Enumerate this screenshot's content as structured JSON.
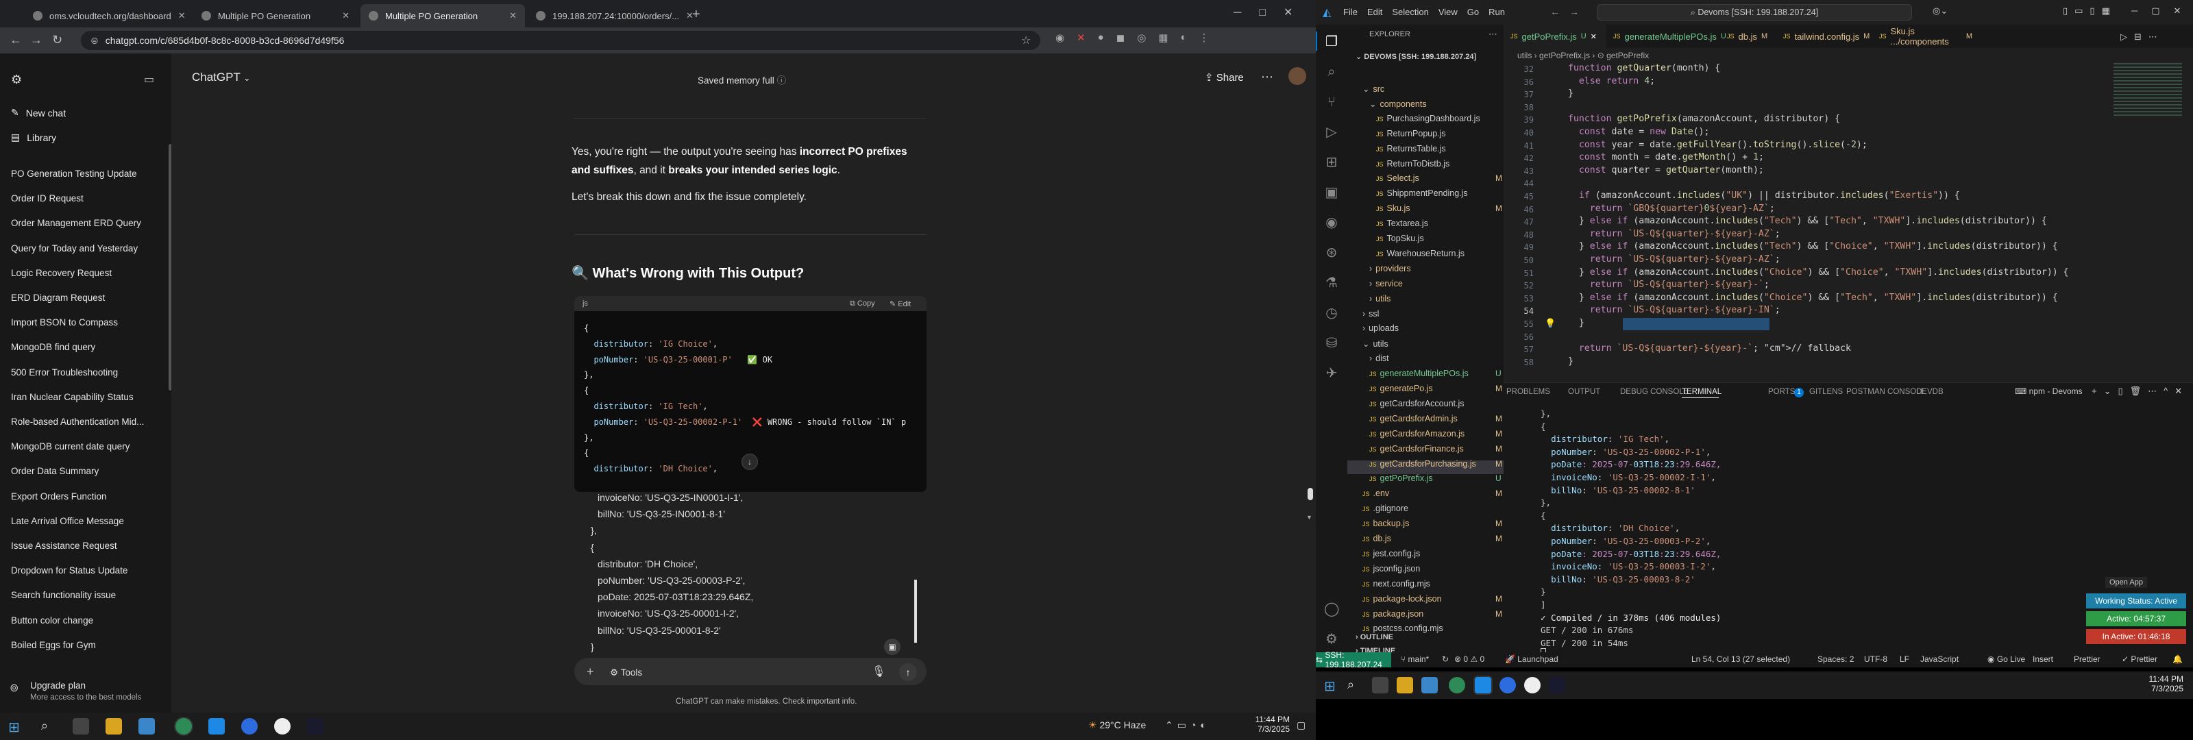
{
  "chrome": {
    "tabs": [
      {
        "label": "oms.vcloudtech.org/dashboard"
      },
      {
        "label": "Multiple PO Generation"
      },
      {
        "label": "Multiple PO Generation"
      },
      {
        "label": "199.188.207.24:10000/orders/..."
      }
    ],
    "url": "chatgpt.com/c/685d4b0f-8c8c-8008-b3cd-8696d7d49f56"
  },
  "chatgpt": {
    "model": "ChatGPT",
    "memory": "Saved memory full",
    "share": "Share",
    "sidebar": {
      "new_chat": "New chat",
      "library": "Library",
      "history": [
        "PO Generation Testing Update",
        "Order ID Request",
        "Order Management ERD Query",
        "Query for Today and Yesterday",
        "Logic Recovery Request",
        "ERD Diagram Request",
        "Import BSON to Compass",
        "MongoDB find query",
        "500 Error Troubleshooting",
        "Iran Nuclear Capability Status",
        "Role-based Authentication Mid...",
        "MongoDB current date query",
        "Order Data Summary",
        "Export Orders Function",
        "Late Arrival Office Message",
        "Issue Assistance Request",
        "Dropdown for Status Update",
        "Search functionality issue",
        "Button color change",
        "Boiled Eggs for Gym"
      ],
      "upgrade_title": "Upgrade plan",
      "upgrade_sub": "More access to the best models"
    },
    "message": {
      "p1a": "Yes, you're right — the output you're seeing has ",
      "p1b": "incorrect PO prefixes",
      "p1c": " and suffixes",
      "p1d": ", and it ",
      "p1e": "breaks your intended series logic",
      "p1f": ".",
      "p2": "Let's break this down and fix the issue completely.",
      "heading": "🔍 What's Wrong with This Output?"
    },
    "code": {
      "lang": "js",
      "copy": "Copy",
      "edit": "Edit",
      "lines": [
        "{",
        "  distributor: 'IG Choice',",
        "  poNumber: 'US-Q3-25-00001-P'   ✅ OK",
        "},",
        "{",
        "  distributor: 'IG Tech',",
        "  poNumber: 'US-Q3-25-00002-P-1'  ❌ WRONG - should follow `IN` p",
        "},",
        "{",
        "  distributor: 'DH Choice',"
      ]
    },
    "pasted": [
      "invoiceNo: 'US-Q3-25-IN0001-I-1',",
      "billNo: 'US-Q3-25-IN0001-8-1'",
      "},",
      "{",
      "distributor: 'DH Choice',",
      "poNumber: 'US-Q3-25-00003-P-2',",
      "poDate: 2025-07-03T18:23:29.646Z,",
      "invoiceNo: 'US-Q3-25-00001-I-2',",
      "billNo: 'US-Q3-25-00001-8-2'",
      "}"
    ],
    "tools": "Tools",
    "disclaimer": "ChatGPT can make mistakes. Check important info."
  },
  "taskbar_left": {
    "weather": "29°C  Haze",
    "time": "11:44 PM",
    "date": "7/3/2025"
  },
  "vscode": {
    "menu": [
      "File",
      "Edit",
      "Selection",
      "View",
      "Go",
      "Run"
    ],
    "search": "Devoms [SSH: 199.188.207.24]",
    "explorer_title": "EXPLORER",
    "root": "DEVOMS [SSH: 199.188.207.24]",
    "tree": [
      {
        "name": "src",
        "mark": ""
      },
      {
        "name": "components",
        "mark": ""
      },
      {
        "name": "PurchasingDashboard.js",
        "mark": ""
      },
      {
        "name": "ReturnPopup.js",
        "mark": ""
      },
      {
        "name": "ReturnsTable.js",
        "mark": ""
      },
      {
        "name": "ReturnToDistb.js",
        "mark": ""
      },
      {
        "name": "Select.js",
        "mark": "M"
      },
      {
        "name": "ShippmentPending.js",
        "mark": ""
      },
      {
        "name": "Sku.js",
        "mark": "M"
      },
      {
        "name": "Textarea.js",
        "mark": ""
      },
      {
        "name": "TopSku.js",
        "mark": ""
      },
      {
        "name": "WarehouseReturn.js",
        "mark": ""
      },
      {
        "name": "providers",
        "mark": ""
      },
      {
        "name": "service",
        "mark": ""
      },
      {
        "name": "utils",
        "mark": ""
      },
      {
        "name": "ssl",
        "mark": ""
      },
      {
        "name": "uploads",
        "mark": ""
      },
      {
        "name": "utils",
        "mark": ""
      },
      {
        "name": "dist",
        "mark": ""
      },
      {
        "name": "generateMultiplePOs.js",
        "mark": "U"
      },
      {
        "name": "generatePo.js",
        "mark": "M"
      },
      {
        "name": "getCardsforAccount.js",
        "mark": ""
      },
      {
        "name": "getCardsforAdmin.js",
        "mark": "M"
      },
      {
        "name": "getCardsforAmazon.js",
        "mark": "M"
      },
      {
        "name": "getCardsforFinance.js",
        "mark": "M"
      },
      {
        "name": "getCardsforPurchasing.js",
        "mark": "M"
      },
      {
        "name": "getPoPrefix.js",
        "mark": "U"
      },
      {
        "name": ".env",
        "mark": "M"
      },
      {
        "name": ".gitignore",
        "mark": ""
      },
      {
        "name": "backup.js",
        "mark": "M"
      },
      {
        "name": "db.js",
        "mark": "M"
      },
      {
        "name": "jest.config.js",
        "mark": ""
      },
      {
        "name": "jsconfig.json",
        "mark": ""
      },
      {
        "name": "next.config.mjs",
        "mark": ""
      },
      {
        "name": "package-lock.json",
        "mark": "M"
      },
      {
        "name": "package.json",
        "mark": "M"
      },
      {
        "name": "postcss.config.mjs",
        "mark": ""
      }
    ],
    "outline": "OUTLINE",
    "timeline": "TIMELINE",
    "tabs": [
      {
        "label": "getPoPrefix.js",
        "mark": "U"
      },
      {
        "label": "generateMultiplePOs.js",
        "mark": "U"
      },
      {
        "label": "db.js",
        "mark": "M"
      },
      {
        "label": "tailwind.config.js",
        "mark": "M"
      },
      {
        "label": "Sku.js .../components",
        "mark": "M"
      }
    ],
    "breadcrumb": "utils  ›  getPoPrefix.js  ›  ⊙ getPoPrefix",
    "line_numbers": [
      "32",
      "36",
      "37",
      "38",
      "39",
      "40",
      "41",
      "42",
      "43",
      "44",
      "45",
      "46",
      "47",
      "48",
      "49",
      "50",
      "51",
      "52",
      "53",
      "54",
      "55",
      "56",
      "57",
      "58"
    ],
    "code": [
      "function getQuarter(month) {",
      "  else return 4;",
      "}",
      "",
      "function getPoPrefix(amazonAccount, distributor) {",
      "  const date = new Date();",
      "  const year = date.getFullYear().toString().slice(-2);",
      "  const month = date.getMonth() + 1;",
      "  const quarter = getQuarter(month);",
      "",
      "  if (amazonAccount.includes(\"UK\") || distributor.includes(\"Exertis\")) {",
      "    return `GBQ${quarter}0${year}-AZ`;",
      "  } else if (amazonAccount.includes(\"Tech\") && [\"Tech\", \"TXWH\"].includes(distributor)) {",
      "    return `US-Q${quarter}-${year}-AZ`;",
      "  } else if (amazonAccount.includes(\"Tech\") && [\"Choice\", \"TXWH\"].includes(distributor)) {",
      "    return `US-Q${quarter}-${year}-AZ`;",
      "  } else if (amazonAccount.includes(\"Choice\") && [\"Choice\", \"TXWH\"].includes(distributor)) {",
      "    return `US-Q${quarter}-${year}-`;",
      "  } else if (amazonAccount.includes(\"Choice\") && [\"Tech\", \"TXWH\"].includes(distributor)) {",
      "    return `US-Q${quarter}-${year}-IN`;",
      "  }",
      "",
      "  return `US-Q${quarter}-${year}-`; // fallback",
      "}"
    ],
    "panel_tabs": [
      "PROBLEMS",
      "OUTPUT",
      "DEBUG CONSOLE",
      "TERMINAL",
      "PORTS",
      "GITLENS",
      "POSTMAN CONSOLE",
      "DEVDB"
    ],
    "ports_count": "1",
    "terminal_name": "npm - Devoms",
    "terminal": [
      "},",
      "{",
      "  distributor: 'IG Tech',",
      "  poNumber: 'US-Q3-25-00002-P-1',",
      "  poDate: 2025-07-03T18:23:29.646Z,",
      "  invoiceNo: 'US-Q3-25-00002-I-1',",
      "  billNo: 'US-Q3-25-00002-8-1'",
      "},",
      "{",
      "  distributor: 'DH Choice',",
      "  poNumber: 'US-Q3-25-00003-P-2',",
      "  poDate: 2025-07-03T18:23:29.646Z,",
      "  invoiceNo: 'US-Q3-25-00003-I-2',",
      "  billNo: 'US-Q3-25-00003-8-2'",
      "}",
      "]",
      "✓ Compiled / in 378ms (406 modules)",
      "GET / 200 in 676ms",
      "GET / 200 in 54ms"
    ],
    "open_app": "Open App",
    "working_status": "Working Status: Active",
    "active_time": "Active: 04:57:37",
    "inactive_time": "In Active: 01:46:18",
    "status": {
      "remote": "SSH: 199.188.207.24",
      "branch": "main*",
      "errors": "0",
      "warnings": "0",
      "launchpad": "Launchpad",
      "position": "Ln 54, Col 13 (27 selected)",
      "spaces": "Spaces: 2",
      "encoding": "UTF-8",
      "eol": "LF",
      "lang": "JavaScript",
      "golive": "Go Live",
      "insert": "Insert",
      "prettier": "Prettier"
    }
  },
  "taskbar_right": {
    "time": "11:44 PM",
    "date": "7/3/2025"
  },
  "colors": {
    "accent_green": "#16825d",
    "badge_active": "#2e9b47",
    "badge_inactive": "#c0392b",
    "badge_status": "#1e7fa8"
  }
}
